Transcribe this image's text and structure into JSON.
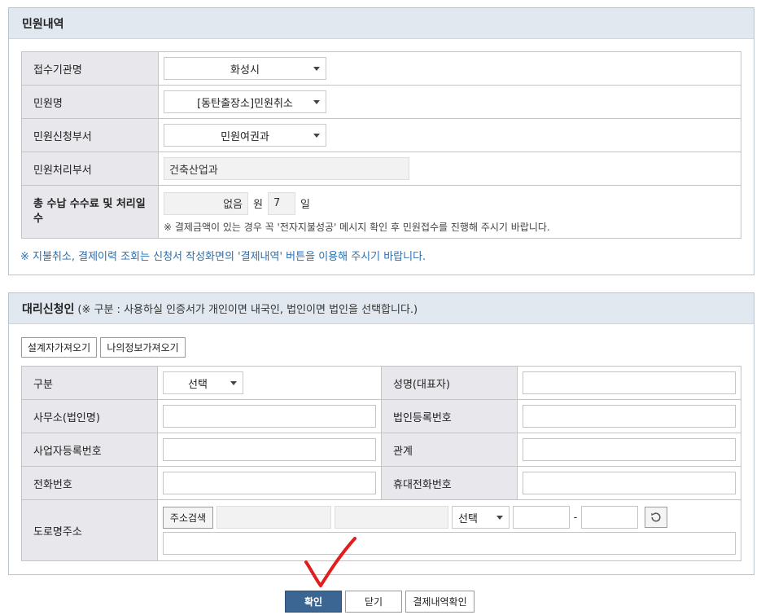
{
  "complaint": {
    "title": "민원내역",
    "agency_label": "접수기관명",
    "agency_value": "화성시",
    "name_label": "민원명",
    "name_value": "[동탄출장소]민원취소",
    "apply_dept_label": "민원신청부서",
    "apply_dept_value": "민원여권과",
    "process_dept_label": "민원처리부서",
    "process_dept_value": "건축산업과",
    "fee_label": "총 수납 수수료 및 처리일수",
    "fee_value": "없음",
    "fee_unit": "원",
    "days_value": "7",
    "days_unit": "일",
    "fee_note": "※ 결제금액이 있는 경우 꼭 '전자지불성공' 메시지 확인 후 민원접수를 진행해 주시기 바랍니다.",
    "info_note": "※ 지불취소, 결제이력 조회는 신청서 작성화면의 '결제내역' 버튼을 이용해 주시기 바랍니다."
  },
  "proxy": {
    "title": "대리신청인",
    "note": "(※ 구분 : 사용하실 인증서가 개인이면 내국인, 법인이면 법인을 선택합니다.)",
    "load_designer_button": "설계자가져오기",
    "load_myinfo_button": "나의정보가져오기",
    "type_label": "구분",
    "type_value": "선택",
    "rep_name_label": "성명(대표자)",
    "office_label": "사무소(법인명)",
    "corp_reg_label": "법인등록번호",
    "biz_reg_label": "사업자등록번호",
    "relation_label": "관계",
    "phone_label": "전화번호",
    "mobile_label": "휴대전화번호",
    "address_label": "도로명주소",
    "address_search_button": "주소검색",
    "address_select_value": "선택",
    "zip_separator": "-"
  },
  "actions": {
    "confirm": "확인",
    "close": "닫기",
    "payment_history": "결제내역확인"
  },
  "colors": {
    "header_bg": "#e1e8f0",
    "label_bg": "#e8e8ec",
    "primary_button": "#3b6592",
    "info_text": "#2a6fb0",
    "annotation_red": "#e01e1e"
  }
}
